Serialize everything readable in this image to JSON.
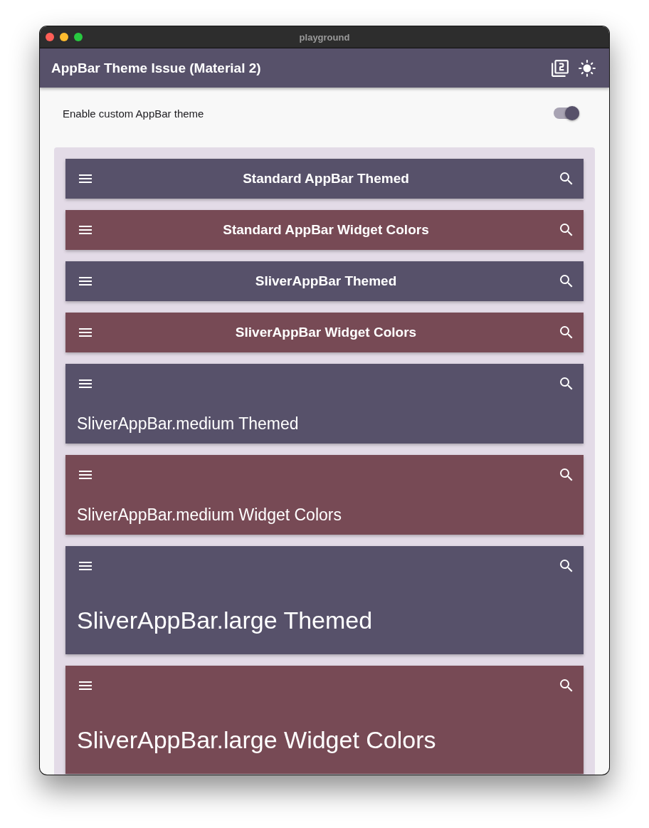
{
  "window": {
    "title": "playground"
  },
  "app_bar": {
    "title": "AppBar Theme Issue (Material 2)"
  },
  "setting": {
    "label": "Enable custom AppBar theme",
    "on": true
  },
  "bars": [
    {
      "kind": "standard",
      "title": "Standard AppBar Themed",
      "color": "#57516a"
    },
    {
      "kind": "standard",
      "title": "Standard AppBar Widget Colors",
      "color": "#774a55"
    },
    {
      "kind": "standard",
      "title": "SliverAppBar Themed",
      "color": "#57516a"
    },
    {
      "kind": "standard",
      "title": "SliverAppBar Widget Colors",
      "color": "#774a55"
    },
    {
      "kind": "medium",
      "title": "SliverAppBar.medium Themed",
      "color": "#57516a"
    },
    {
      "kind": "medium",
      "title": "SliverAppBar.medium Widget Colors",
      "color": "#774a55"
    },
    {
      "kind": "large",
      "title": "SliverAppBar.large Themed",
      "color": "#57516a"
    },
    {
      "kind": "large",
      "title": "SliverAppBar.large Widget Colors",
      "color": "#774a55"
    }
  ]
}
